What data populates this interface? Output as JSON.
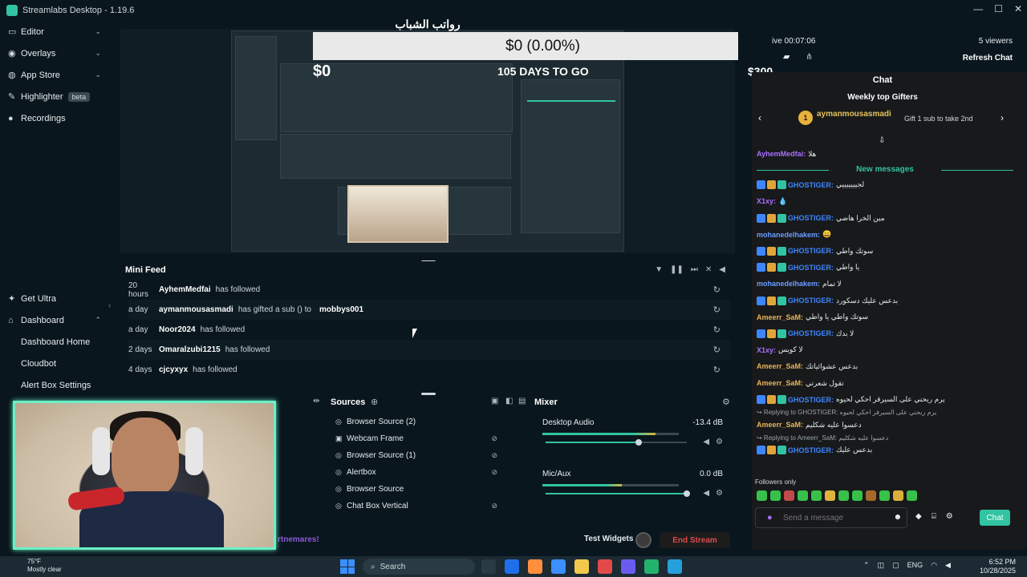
{
  "window": {
    "title": "Streamlabs Desktop - 1.19.6",
    "controls": [
      "—",
      "☐",
      "✕"
    ]
  },
  "sidebar": {
    "items": [
      {
        "label": "Editor",
        "icon": "editor-icon"
      },
      {
        "label": "Overlays",
        "icon": "overlays-icon"
      },
      {
        "label": "App Store",
        "icon": "app-store-icon"
      },
      {
        "label": "Highlighter",
        "icon": "highlighter-icon",
        "badge": "beta"
      },
      {
        "label": "Recordings",
        "icon": "recordings-icon"
      }
    ],
    "get_ultra": "Get Ultra",
    "dashboard": "Dashboard",
    "dashboard_children": [
      "Dashboard Home",
      "Cloudbot",
      "Alert Box Settings"
    ]
  },
  "preview": {
    "arabic_title": "رواتب الشباب",
    "goal_bar_text": "$0 (0.00%)",
    "goal_left": "$0",
    "goal_days": "105 DAYS TO GO",
    "goal_right": "$300"
  },
  "mini_feed": {
    "title": "Mini Feed",
    "rows": [
      {
        "time": "20 hours",
        "who": "AyhemMedfai",
        "action": "has followed",
        "target": ""
      },
      {
        "time": "a day",
        "who": "aymanmousasmadi",
        "action": "has gifted a sub () to",
        "target": "mobbys001"
      },
      {
        "time": "a day",
        "who": "Noor2024",
        "action": "has followed",
        "target": ""
      },
      {
        "time": "2 days",
        "who": "Omaralzubi1215",
        "action": "has followed",
        "target": ""
      },
      {
        "time": "4 days",
        "who": "cjcyxyx",
        "action": "has followed",
        "target": ""
      }
    ]
  },
  "sources": {
    "title": "Sources",
    "items": [
      "Browser Source (2)",
      "Webcam Frame",
      "Browser Source (1)",
      "Alertbox",
      "Browser Source",
      "Chat Box Vertical"
    ]
  },
  "mixer": {
    "title": "Mixer",
    "channels": [
      {
        "name": "Desktop Audio",
        "db": "-13.4 dB",
        "meter": 0.83,
        "volume": 0.66
      },
      {
        "name": "Mic/Aux",
        "db": "0.0 dB",
        "meter": 0.58,
        "volume": 1.0
      }
    ]
  },
  "bottom": {
    "ticker": "rtnemares!",
    "test_widgets": "Test Widgets",
    "end_stream": "End Stream"
  },
  "chat_top": {
    "live_time": "ive 00:07:06",
    "viewers": "5 viewers",
    "refresh": "Refresh Chat",
    "goal_right": "$300"
  },
  "chat": {
    "title": "Chat",
    "gifters_title": "Weekly top Gifters",
    "gifter_rank": "1",
    "gifter_name": "aymanmousasmadi",
    "gifter_note": "Gift 1 sub to take 2nd",
    "messages_before": [
      {
        "name": "X1xy",
        "color": "#a970ff",
        "text": ""
      },
      {
        "name": "AyhemMedfai",
        "color": "#a970ff",
        "text": "هلا"
      }
    ],
    "new_messages_label": "New messages",
    "messages": [
      {
        "name": "GHOSTIGER",
        "color": "#3d86ff",
        "text": "لجيييييييي",
        "badges": true
      },
      {
        "name": "X1xy",
        "color": "#a970ff",
        "text": "💧",
        "badges": false
      },
      {
        "name": "GHOSTIGER",
        "color": "#3d86ff",
        "text": "مين الخرا هاضي",
        "badges": true
      },
      {
        "name": "mohanedelhakem",
        "color": "#6c9cff",
        "text": "😀",
        "badges": false
      },
      {
        "name": "GHOSTIGER",
        "color": "#3d86ff",
        "text": "سوتك واطي",
        "badges": true
      },
      {
        "name": "GHOSTIGER",
        "color": "#3d86ff",
        "text": "يا واطي",
        "badges": true
      },
      {
        "name": "mohanedelhakem",
        "color": "#6c9cff",
        "text": "لا تمام",
        "badges": false
      },
      {
        "name": "GHOSTIGER",
        "color": "#3d86ff",
        "text": "بدعس عليك دسكورد",
        "badges": true
      },
      {
        "name": "Ameerr_SaM",
        "color": "#e6b45a",
        "text": "سوتك واطي يا واطي",
        "badges": false
      },
      {
        "name": "GHOSTIGER",
        "color": "#3d86ff",
        "text": "لا بدك",
        "badges": true
      },
      {
        "name": "X1xy",
        "color": "#a970ff",
        "text": "لا كويس",
        "badges": false
      },
      {
        "name": "Ameerr_SaM",
        "color": "#e6b45a",
        "text": "بدعس عشوائياتك",
        "badges": false
      },
      {
        "name": "Ameerr_SaM",
        "color": "#e6b45a",
        "text": "تقول شعرتي",
        "badges": false
      },
      {
        "name": "GHOSTIGER",
        "color": "#3d86ff",
        "text": "يرم ربحني على السيرفر احكي لحيوه",
        "badges": true
      }
    ],
    "reply1": "Replying to GHOSTIGER: يرم ربحني على السيرفر احكي لحيوه",
    "reply1_msg": {
      "name": "Ameerr_SaM",
      "color": "#e6b45a",
      "text": "دعسوا عليه شكليم"
    },
    "reply2": "Replying to Ameerr_SaM: دعسوا عليه شكليم",
    "reply2_msg": {
      "name": "GHOSTIGER",
      "color": "#3d86ff",
      "text": "بدعس عليك"
    },
    "followers_only": "Followers only",
    "input_placeholder": "Send a message",
    "send_label": "Chat",
    "emote_colors": [
      "#37c14a",
      "#37c14a",
      "#c24a4a",
      "#37c14a",
      "#37c14a",
      "#e0b23e",
      "#37c14a",
      "#37c14a",
      "#a56a2a",
      "#37c14a",
      "#d9b13a",
      "#37c14a"
    ]
  },
  "taskbar": {
    "weather_temp": "75°F",
    "weather_desc": "Mostly clear",
    "search_label": "Search",
    "lang": "ENG",
    "time": "6:52 PM",
    "date": "10/28/2025",
    "app_colors": [
      "#2a3a44",
      "#1f6feb",
      "#ff8f3d",
      "#3c8fff",
      "#f2c94c",
      "#e24a4a",
      "#6b5cf0",
      "#23b26b",
      "#26a0da"
    ]
  },
  "colors": {
    "accent": "#31c3a2",
    "bg": "#09161d",
    "end_stream": "#e04a4a"
  }
}
